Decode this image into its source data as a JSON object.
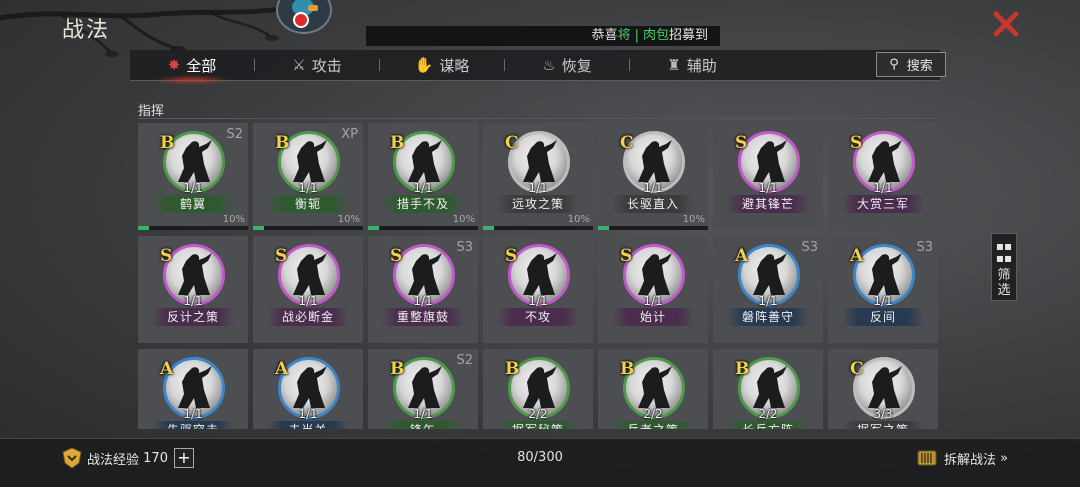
{
  "header": {
    "title": "战法",
    "banner": {
      "prefix": "恭喜",
      "highlight": "将",
      "separator": "|",
      "player": "肉包",
      "suffix": "招募到"
    },
    "close_icon": "close-x-icon",
    "close_color": "#c8372d"
  },
  "tabs": [
    {
      "label": "全部",
      "icon": "scroll-icon",
      "active": true
    },
    {
      "label": "攻击",
      "icon": "crossed-swords-icon",
      "active": false
    },
    {
      "label": "谋略",
      "icon": "hand-icon",
      "active": false
    },
    {
      "label": "恢复",
      "icon": "pot-icon",
      "active": false
    },
    {
      "label": "辅助",
      "icon": "bag-icon",
      "active": false
    }
  ],
  "search": {
    "label": "搜索",
    "icon": "search-icon"
  },
  "section": {
    "title": "指挥"
  },
  "grade_ring_colors": {
    "B": "#4e9a4a",
    "C": "#bdbdbd",
    "S": "#c05ac8",
    "A": "#3d86c8"
  },
  "cards": [
    {
      "grade": "B",
      "tag": "S2",
      "level": "1/1",
      "name": "鹤翼",
      "percent": "10%",
      "progress": 0.1
    },
    {
      "grade": "B",
      "tag": "XP",
      "level": "1/1",
      "name": "衡轭",
      "percent": "10%",
      "progress": 0.1
    },
    {
      "grade": "B",
      "tag": "",
      "level": "1/1",
      "name": "措手不及",
      "percent": "10%",
      "progress": 0.1
    },
    {
      "grade": "C",
      "tag": "",
      "level": "1/1",
      "name": "远攻之策",
      "percent": "10%",
      "progress": 0.1
    },
    {
      "grade": "C",
      "tag": "",
      "level": "1/1",
      "name": "长驱直入",
      "percent": "10%",
      "progress": 0.1
    },
    {
      "grade": "S",
      "tag": "",
      "level": "1/1",
      "name": "避其锋芒",
      "percent": "",
      "progress": null
    },
    {
      "grade": "S",
      "tag": "",
      "level": "1/1",
      "name": "大赏三军",
      "percent": "",
      "progress": null
    },
    {
      "grade": "S",
      "tag": "",
      "level": "1/1",
      "name": "反计之策",
      "percent": "",
      "progress": null
    },
    {
      "grade": "S",
      "tag": "",
      "level": "1/1",
      "name": "战必断金",
      "percent": "",
      "progress": null
    },
    {
      "grade": "S",
      "tag": "S3",
      "level": "1/1",
      "name": "重整旗鼓",
      "percent": "",
      "progress": null
    },
    {
      "grade": "S",
      "tag": "",
      "level": "1/1",
      "name": "不攻",
      "percent": "",
      "progress": null
    },
    {
      "grade": "S",
      "tag": "",
      "level": "1/1",
      "name": "始计",
      "percent": "",
      "progress": null
    },
    {
      "grade": "A",
      "tag": "S3",
      "level": "1/1",
      "name": "磐阵善守",
      "percent": "",
      "progress": null
    },
    {
      "grade": "A",
      "tag": "S3",
      "level": "1/1",
      "name": "反间",
      "percent": "",
      "progress": null
    },
    {
      "grade": "A",
      "tag": "",
      "level": "1/1",
      "name": "先驱突击",
      "percent": "",
      "progress": null
    },
    {
      "grade": "A",
      "tag": "",
      "level": "1/1",
      "name": "夫当关",
      "percent": "",
      "progress": null
    },
    {
      "grade": "B",
      "tag": "S2",
      "level": "1/1",
      "name": "锋矢",
      "percent": "",
      "progress": null
    },
    {
      "grade": "B",
      "tag": "",
      "level": "2/2",
      "name": "据军秘策",
      "percent": "",
      "progress": null
    },
    {
      "grade": "B",
      "tag": "",
      "level": "2/2",
      "name": "兵老之策",
      "percent": "",
      "progress": null
    },
    {
      "grade": "B",
      "tag": "",
      "level": "2/2",
      "name": "长兵方阵",
      "percent": "",
      "progress": null
    },
    {
      "grade": "C",
      "tag": "",
      "level": "3/3",
      "name": "据军之策",
      "percent": "",
      "progress": null
    }
  ],
  "filter": {
    "label": "筛选",
    "icon": "grid-filter-icon"
  },
  "footer": {
    "exp_label": "战法经验",
    "exp_value": "170",
    "plus_label": "+",
    "count": "80/300",
    "decompose_label": "拆解战法",
    "decompose_arrow": "»"
  }
}
